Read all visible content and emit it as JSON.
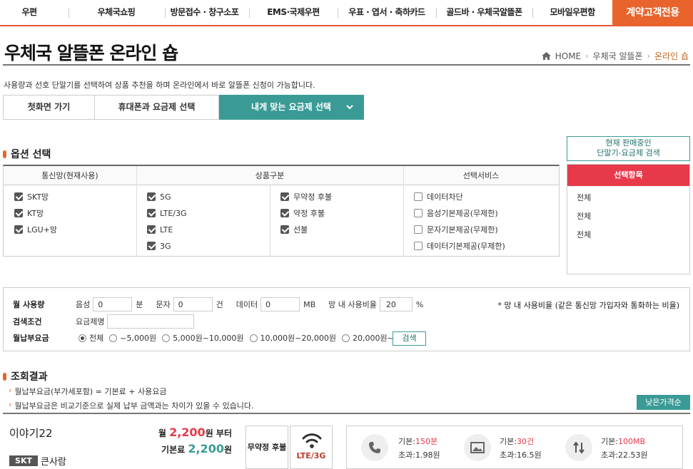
{
  "topnav": {
    "items": [
      "우편",
      "우체국쇼핑",
      "방문접수 · 창구소포",
      "EMS·국제우편",
      "우표 · 엽서 · 축하카드",
      "골드바 · 우체국알뜰폰",
      "모바일우편함"
    ],
    "contract": "계약고객전용"
  },
  "page": {
    "title": "우체국 알뜰폰 온라인 숍",
    "breadcrumb": [
      "HOME",
      "우체국 알뜰폰",
      "온라인 숍"
    ],
    "description": "사용량과 선호 단말기를 선택하여 상품 추천을 하며 온라인에서 바로 알뜰폰 신청이 가능합니다."
  },
  "steps": [
    "첫화면 가기",
    "휴대폰과 요금제 선택",
    "내게 맞는 요금제 선택"
  ],
  "options": {
    "title": "옵션 선택",
    "headers": [
      "통신망(현재사용)",
      "상품구분",
      "선택서비스"
    ],
    "network": [
      {
        "label": "SKT망",
        "checked": true
      },
      {
        "label": "KT망",
        "checked": true
      },
      {
        "label": "LGU+망",
        "checked": true
      }
    ],
    "generation": [
      {
        "label": "5G",
        "checked": true
      },
      {
        "label": "LTE/3G",
        "checked": true
      },
      {
        "label": "LTE",
        "checked": true
      },
      {
        "label": "3G",
        "checked": true
      }
    ],
    "contract": [
      {
        "label": "무약정 후불",
        "checked": true
      },
      {
        "label": "약정 후불",
        "checked": true
      },
      {
        "label": "선불",
        "checked": true
      }
    ],
    "services": [
      {
        "label": "데이터차단",
        "checked": false
      },
      {
        "label": "음성기본제공(무제한)",
        "checked": false
      },
      {
        "label": "문자기본제공(무제한)",
        "checked": false
      },
      {
        "label": "데이터기본제공(무제한)",
        "checked": false
      }
    ]
  },
  "side": {
    "search_line1": "현재 판매중인",
    "search_line2": "단말기-요금제 검색",
    "selected_title": "선택항목",
    "selected_items": [
      "전체",
      "전체",
      "전체"
    ]
  },
  "filter": {
    "usage_label": "월 사용량",
    "voice_label": "음성",
    "voice_value": "0",
    "voice_unit": "분",
    "sms_label": "문자",
    "sms_value": "0",
    "sms_unit": "건",
    "data_label": "데이터",
    "data_value": "0",
    "data_unit": "MB",
    "ratio_label": "망 내 사용비율",
    "ratio_value": "20",
    "ratio_unit": "%",
    "note": "* 망 내 사용비율 (같은 통신망 가입자와 통화하는 비율)",
    "search_label": "검색조건",
    "plan_name_label": "요금제명",
    "plan_name_value": "",
    "fee_label": "월납부요금",
    "fee_options": [
      "전체",
      "~5,000원",
      "5,000원~10,000원",
      "10,000원~20,000원",
      "20,000원~"
    ],
    "fee_selected": 0,
    "search_button": "검색"
  },
  "results": {
    "title": "조회결과",
    "info1": "월납부요금(부가세포함) = 기본료 + 사용요금",
    "info2": "월납부요금은 비교기준으로 실제 납부 금액과는 차이가 있을 수 있습니다.",
    "sort_button": "낮은가격순",
    "product": {
      "name": "이야기22",
      "carrier": "SKT",
      "plan": "큰사람",
      "price_prefix": "월",
      "price": "2,200",
      "price_suffix": "원 부터",
      "base_prefix": "기본료",
      "base_price": "2,200",
      "base_suffix": "원",
      "contract_tag": "무약정 후불",
      "network_tag": "LTE/3G",
      "voice_base_label": "기본:",
      "voice_base": "150분",
      "voice_over": "초과:1.98원",
      "sms_base_label": "기본:",
      "sms_base": "30건",
      "sms_over": "초과:16.5원",
      "data_base_label": "기본:",
      "data_base": "100MB",
      "data_over": "초과:22.53원"
    }
  }
}
